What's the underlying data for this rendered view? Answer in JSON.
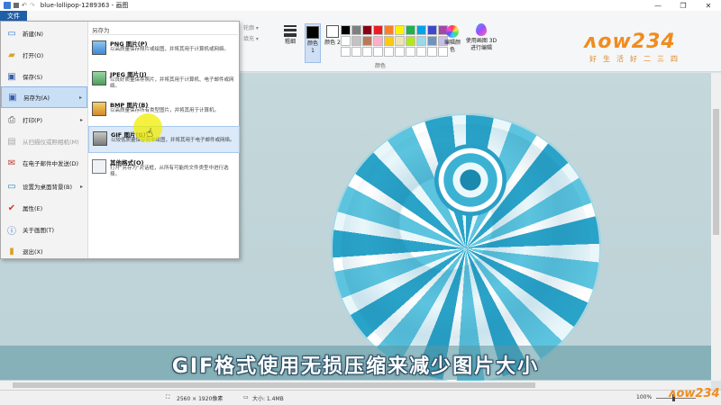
{
  "window": {
    "title": "blue-lollipop-1289363 - 画图",
    "controls": [
      "—",
      "❐",
      "✕"
    ]
  },
  "ribbon": {
    "file_tab": "文件",
    "tools_stub": [
      "轮廓 ▾",
      "填充 ▾"
    ],
    "size_label": "粗细",
    "color1_label": "颜色 1",
    "color2_label": "颜色 2",
    "edit_colors_label": "编辑颜色",
    "paint3d_label": "使用画图 3D 进行编辑",
    "colors_group_label": "颜色",
    "palette": [
      "#000000",
      "#7f7f7f",
      "#880015",
      "#ed1c24",
      "#ff7f27",
      "#fff200",
      "#22b14c",
      "#00a2e8",
      "#3f48cc",
      "#a349a4",
      "#ffffff",
      "#c3c3c3",
      "#b97a57",
      "#ffaec9",
      "#ffc90e",
      "#efe4b0",
      "#b5e61d",
      "#99d9ea",
      "#7092be",
      "#c8bfe7",
      "#ffffff",
      "#ffffff",
      "#ffffff",
      "#ffffff",
      "#ffffff",
      "#ffffff",
      "#ffffff",
      "#ffffff",
      "#ffffff",
      "#ffffff"
    ]
  },
  "watermark": {
    "logo": "ʌow234",
    "sub": "好生活好二三四",
    "small": "ʌow234"
  },
  "file_menu": {
    "items": [
      {
        "label": "新建(N)",
        "icon": "new-file-icon"
      },
      {
        "label": "打开(O)",
        "icon": "open-folder-icon"
      },
      {
        "label": "保存(S)",
        "icon": "save-icon"
      },
      {
        "label": "另存为(A)",
        "icon": "save-as-icon",
        "arrow": "▸",
        "selected": true
      },
      {
        "label": "打印(P)",
        "icon": "print-icon",
        "arrow": "▸"
      },
      {
        "label": "从扫描仪或照相机(M)",
        "icon": "scanner-icon",
        "disabled": true
      },
      {
        "label": "在电子邮件中发送(D)",
        "icon": "email-icon"
      },
      {
        "label": "设置为桌面背景(B)",
        "icon": "desktop-background-icon",
        "arrow": "▸"
      },
      {
        "label": "属性(E)",
        "icon": "properties-check-icon"
      },
      {
        "label": "关于画图(T)",
        "icon": "info-icon"
      },
      {
        "label": "退出(X)",
        "icon": "exit-icon"
      }
    ],
    "submenu_header": "另存为",
    "options": [
      {
        "name": "PNG 图片(P)",
        "desc": "以高质量保存照片或绘图，并将其用于计算机或网络。",
        "icon": "png-icon"
      },
      {
        "name": "JPEG 图片(J)",
        "desc": "以良好质量保存照片，并将其用于计算机、电子邮件或网络。",
        "icon": "jpeg-icon"
      },
      {
        "name": "BMP 图片(B)",
        "desc": "以高质量保存所有类型图片，并将其用于计算机。",
        "icon": "bmp-icon"
      },
      {
        "name": "GIF 图片(G)",
        "desc": "以较低质量保存简单绘图，并将其用于电子邮件或网络。",
        "icon": "gif-icon",
        "highlighted": true
      },
      {
        "name": "其他格式(O)",
        "desc": "打开\"另存为\"对话框，从所有可能的文件类型中进行选择。",
        "icon": "other-formats-icon"
      }
    ]
  },
  "subtitle": "GIF格式使用无损压缩来减少图片大小",
  "status": {
    "dimensions": "2560 × 1920像素",
    "size": "大小: 1.4MB",
    "zoom": "100%"
  }
}
